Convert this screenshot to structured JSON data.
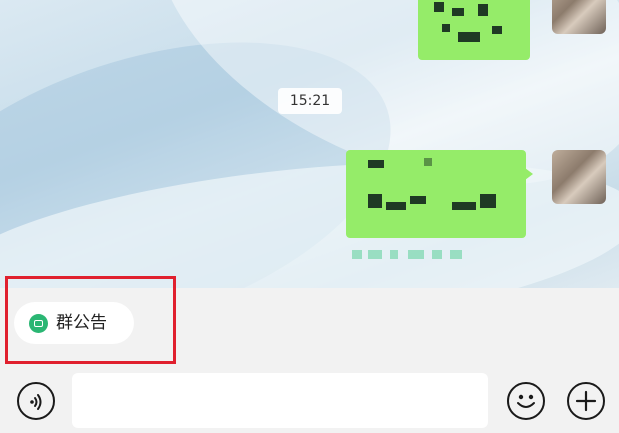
{
  "chat": {
    "time_divider": "15:21"
  },
  "announcement": {
    "label": "群公告",
    "icon": "announcement-icon"
  },
  "input_bar": {
    "placeholder": "",
    "voice_icon": "voice-icon",
    "emoji_icon": "emoji-icon",
    "plus_icon": "plus-icon"
  },
  "colors": {
    "bubble": "#95ec69",
    "highlight": "#e0202e",
    "announce_icon": "#2ab673"
  }
}
